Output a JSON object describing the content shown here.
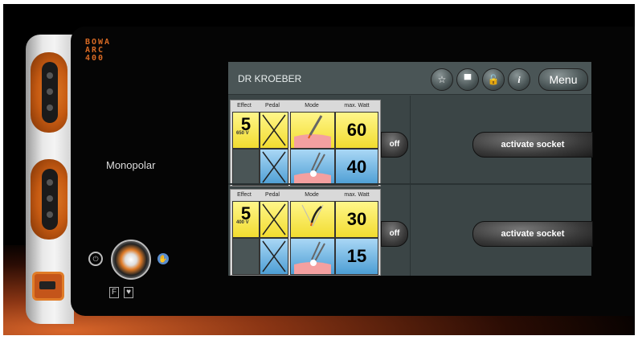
{
  "device": {
    "brand_lines": [
      "BOWA",
      "ARC",
      "400"
    ],
    "mode_label": "Monopolar"
  },
  "screen": {
    "title": "DR KROEBER",
    "toolbar": {
      "star_icon": "star-icon",
      "monitor_icon": "monitor-icon",
      "lock_icon": "unlock-icon",
      "info_icon": "info-icon",
      "info_glyph": "i",
      "menu_label": "Menu"
    },
    "headers": [
      "Effect",
      "Pedal",
      "Mode",
      "max. Watt"
    ],
    "channels": [
      {
        "effect": "5",
        "voltage": "650 V",
        "watt_top": "60",
        "watt_bottom": "40",
        "off_label": "off",
        "activate_label": "activate socket"
      },
      {
        "effect": "5",
        "voltage": "400 V",
        "watt_top": "30",
        "watt_bottom": "15",
        "off_label": "off",
        "activate_label": "activate socket"
      }
    ],
    "colors": {
      "yellow": "#f2dc30",
      "blue": "#4d9ed4",
      "screen_bg": "#3b4546",
      "accent_orange": "#e07c28"
    }
  }
}
